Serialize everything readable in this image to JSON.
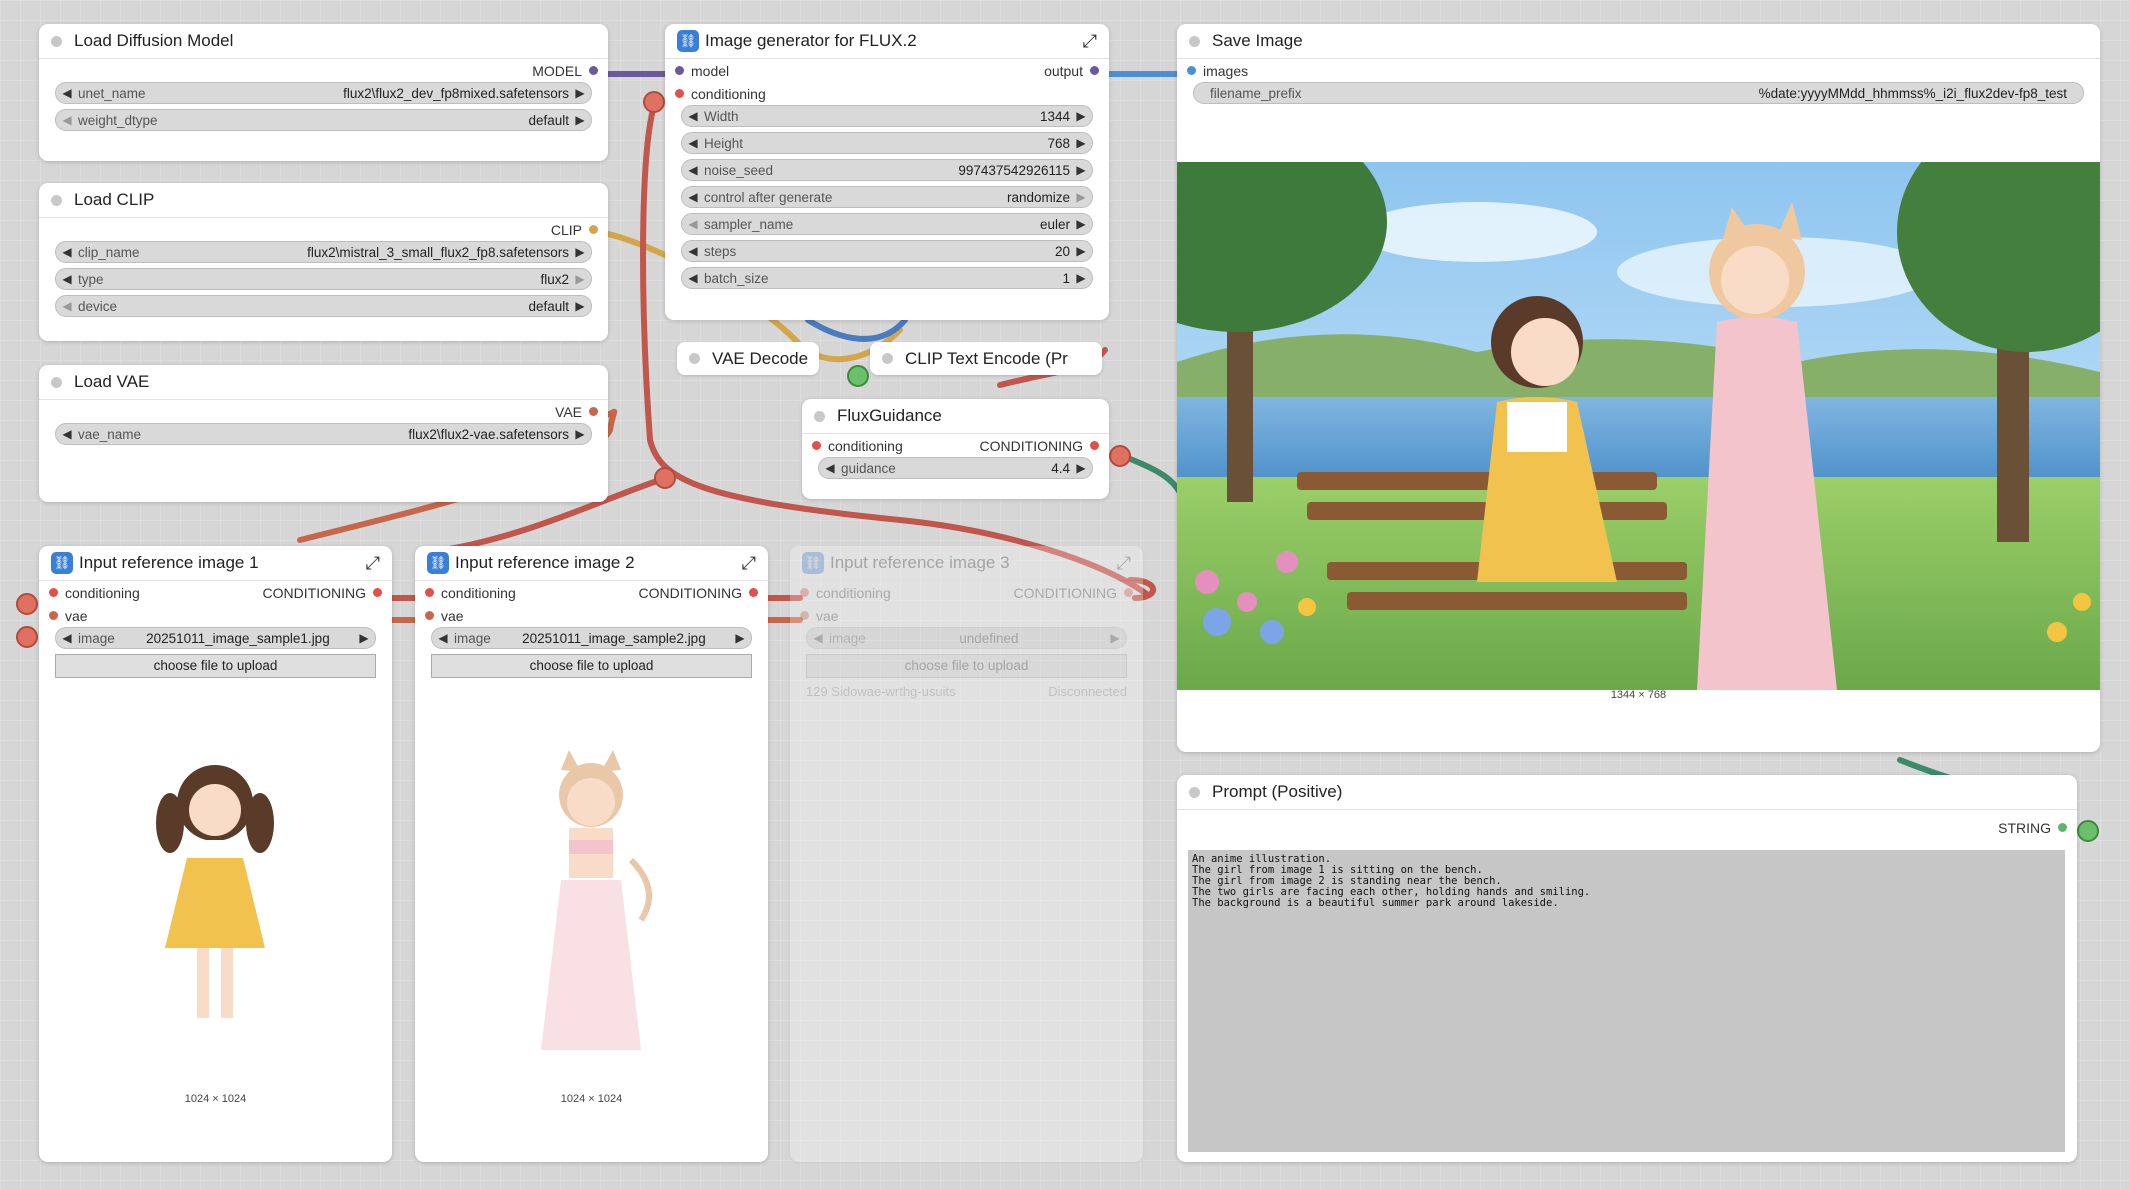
{
  "nodes": {
    "load_diffusion": {
      "title": "Load Diffusion Model",
      "output": "MODEL",
      "widgets": [
        {
          "name": "unet_name",
          "value": "flux2\\flux2_dev_fp8mixed.safetensors"
        },
        {
          "name": "weight_dtype",
          "value": "default"
        }
      ]
    },
    "load_clip": {
      "title": "Load CLIP",
      "output": "CLIP",
      "widgets": [
        {
          "name": "clip_name",
          "value": "flux2\\mistral_3_small_flux2_fp8.safetensors"
        },
        {
          "name": "type",
          "value": "flux2"
        },
        {
          "name": "device",
          "value": "default"
        }
      ]
    },
    "load_vae": {
      "title": "Load VAE",
      "output": "VAE",
      "widgets": [
        {
          "name": "vae_name",
          "value": "flux2\\flux2-vae.safetensors"
        }
      ]
    },
    "generator": {
      "title": "Image generator for FLUX.2",
      "inputs": [
        "model",
        "conditioning"
      ],
      "output": "output",
      "widgets": [
        {
          "name": "Width",
          "value": "1344"
        },
        {
          "name": "Height",
          "value": "768"
        },
        {
          "name": "noise_seed",
          "value": "997437542926115"
        },
        {
          "name": "control after generate",
          "value": "randomize"
        },
        {
          "name": "sampler_name",
          "value": "euler"
        },
        {
          "name": "steps",
          "value": "20"
        },
        {
          "name": "batch_size",
          "value": "1"
        }
      ]
    },
    "vae_decode": {
      "title": "VAE Decode"
    },
    "clip_text_encode": {
      "title": "CLIP Text Encode (Pr"
    },
    "flux_guidance": {
      "title": "FluxGuidance",
      "input": "conditioning",
      "output": "CONDITIONING",
      "widgets": [
        {
          "name": "guidance",
          "value": "4.4"
        }
      ]
    },
    "save_image": {
      "title": "Save Image",
      "input": "images",
      "widgets": [
        {
          "name": "filename_prefix",
          "value": "%date:yyyyMMdd_hhmmss%_i2i_flux2dev-fp8_test"
        }
      ],
      "dims": "1344 × 768"
    },
    "ref1": {
      "title": "Input reference image 1",
      "inputs": [
        "conditioning",
        "vae"
      ],
      "output": "CONDITIONING",
      "widgets": [
        {
          "name": "image",
          "value": "20251011_image_sample1.jpg"
        }
      ],
      "upload_label": "choose file to upload",
      "dims": "1024 × 1024"
    },
    "ref2": {
      "title": "Input reference image 2",
      "inputs": [
        "conditioning",
        "vae"
      ],
      "output": "CONDITIONING",
      "widgets": [
        {
          "name": "image",
          "value": "20251011_image_sample2.jpg"
        }
      ],
      "upload_label": "choose file to upload",
      "dims": "1024 × 1024"
    },
    "ref3": {
      "title": "Input reference image 3",
      "inputs": [
        "conditioning",
        "vae"
      ],
      "output": "CONDITIONING",
      "widgets": [
        {
          "name": "image",
          "value": "undefined"
        }
      ],
      "upload_label": "choose file to upload",
      "status": "129 Sidowae-wrthg-usuits",
      "status2": "Disconnected"
    },
    "prompt": {
      "title": "Prompt (Positive)",
      "output": "STRING",
      "text": "An anime illustration.\nThe girl from image 1 is sitting on the bench.\nThe girl from image 2 is standing near the bench.\nThe two girls are facing each other, holding hands and smiling.\nThe background is a beautiful summer park around lakeside."
    }
  },
  "colors": {
    "model": "#7b5ea7",
    "clip": "#e0b23a",
    "vae": "#e0603f",
    "conditioning": "#e2504a",
    "image": "#4a8fd8",
    "string": "#5fb36b"
  },
  "icons": {
    "node_badge": "workflow-icon",
    "expand": "expand-icon",
    "arrow_left": "◀",
    "arrow_right": "▶"
  }
}
